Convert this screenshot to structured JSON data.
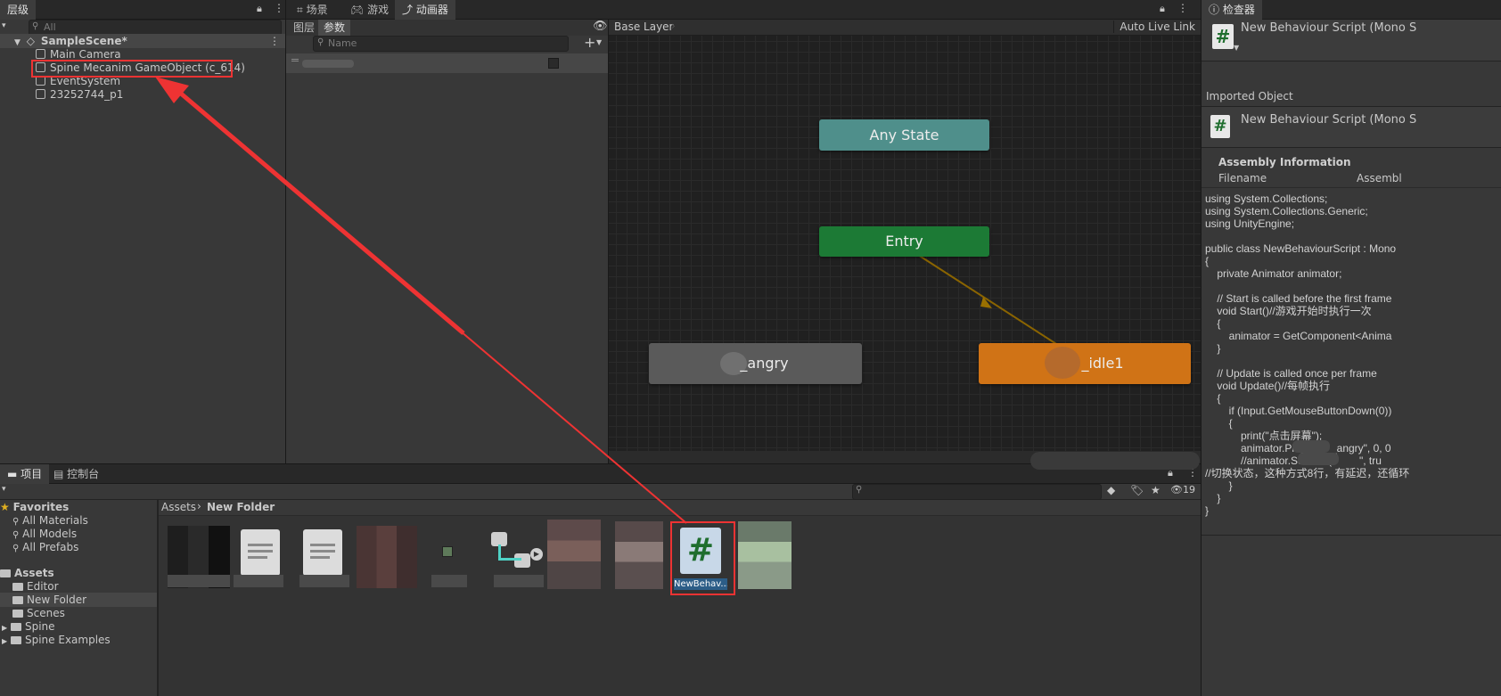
{
  "hierarchy": {
    "tab": "层级",
    "search_placeholder": "All",
    "scene_name": "SampleScene*",
    "items": [
      "Main Camera",
      "Spine Mecanim GameObject (c_614)",
      "EventSystem",
      "23252744_p1"
    ]
  },
  "center_tabs": {
    "scene": "场景",
    "game": "游戏",
    "animator": "动画器"
  },
  "animator": {
    "subtabs": [
      "图层",
      "参数"
    ],
    "param_search_placeholder": "Name",
    "breadcrumb": "Base Layer",
    "auto_live_link": "Auto Live Link",
    "nodes": {
      "any_state": "Any State",
      "entry": "Entry",
      "angry": "_angry",
      "idle": "_idle1"
    }
  },
  "inspector": {
    "tab": "检查器",
    "header_title": "New Behaviour Script (Mono S",
    "imported_object": "Imported Object",
    "imported_title": "New Behaviour Script (Mono S",
    "assembly_info": "Assembly Information",
    "filename_label": "Filename",
    "filename_value": "Assembl",
    "code_lines": [
      "using System.Collections;",
      "using System.Collections.Generic;",
      "using UnityEngine;",
      "",
      "public class NewBehaviourScript : Mono",
      "{",
      "    private Animator animator;",
      "",
      "    // Start is called before the first frame",
      "    void Start()//游戏开始时执行一次",
      "    {",
      "        animator = GetComponent<Anima",
      "    }",
      "",
      "    // Update is called once per frame",
      "    void Update()//每帧执行",
      "    {",
      "        if (Input.GetMouseButtonDown(0))",
      "        {",
      "            print(\"点击屏幕\");",
      "            animator.Play(\"      _angry\", 0, 0",
      "            //animator.SetBool(\"        \", tru",
      "//切换状态，这种方式8行，有延迟，还循环",
      "        }",
      "    }",
      "}"
    ]
  },
  "project": {
    "tab_project": "项目",
    "tab_console": "控制台",
    "favorites_label": "Favorites",
    "favorites": [
      "All Materials",
      "All Models",
      "All Prefabs"
    ],
    "assets_label": "Assets",
    "folders": [
      "Editor",
      "New Folder",
      "Scenes",
      "Spine",
      "Spine Examples"
    ],
    "breadcrumb_root": "Assets",
    "breadcrumb_current": "New Folder",
    "hidden_count": "19",
    "selected_asset_label": "NewBehav..."
  },
  "colors": {
    "any_state": "#4f8f8b",
    "entry": "#1c7a35",
    "idle": "#d07316",
    "angry": "#5a5a5a",
    "annotation": "#ee3333",
    "script_icon": "#1f6e2e"
  }
}
